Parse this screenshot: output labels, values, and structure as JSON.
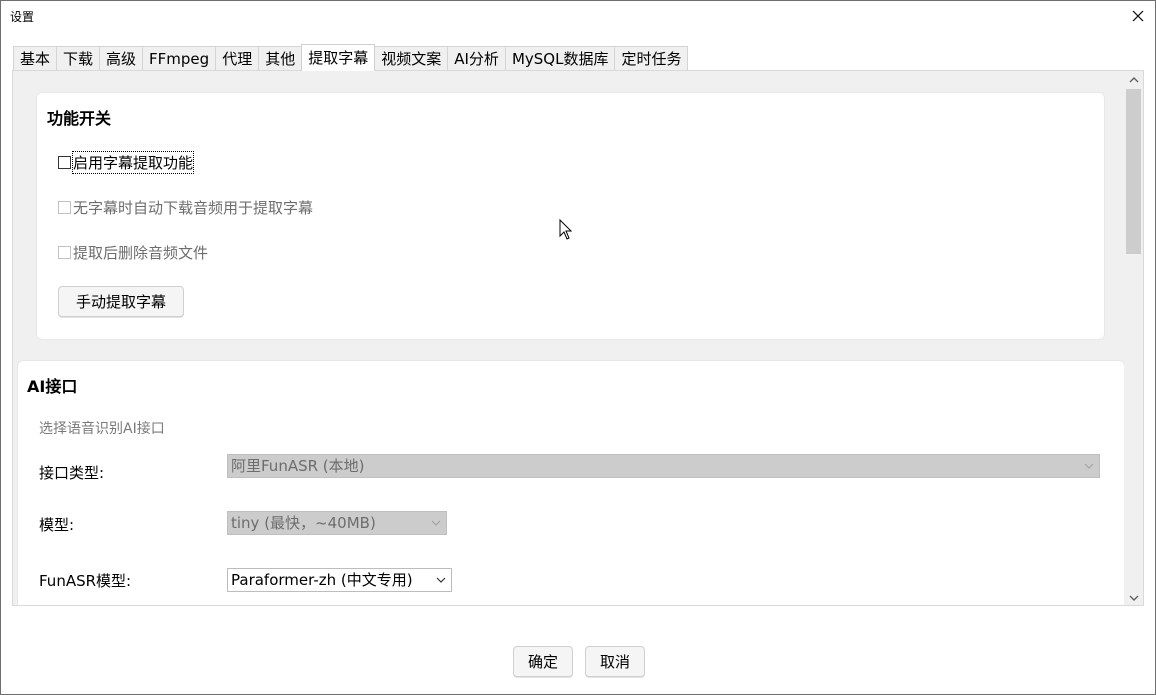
{
  "window": {
    "title": "设置"
  },
  "tabs": [
    {
      "label": "基本"
    },
    {
      "label": "下载"
    },
    {
      "label": "高级"
    },
    {
      "label": "FFmpeg"
    },
    {
      "label": "代理"
    },
    {
      "label": "其他"
    },
    {
      "label": "提取字幕",
      "active": true
    },
    {
      "label": "视频文案"
    },
    {
      "label": "AI分析"
    },
    {
      "label": "MySQL数据库"
    },
    {
      "label": "定时任务"
    }
  ],
  "feature_group": {
    "title": "功能开关",
    "enable_extract": {
      "label": "启用字幕提取功能",
      "checked": false,
      "enabled": true
    },
    "auto_download_audio": {
      "label": "无字幕时自动下载音频用于提取字幕",
      "checked": false,
      "enabled": false
    },
    "delete_audio": {
      "label": "提取后删除音频文件",
      "checked": false,
      "enabled": false
    },
    "manual_button": "手动提取字幕"
  },
  "ai_group": {
    "title": "AI接口",
    "hint": "选择语音识别AI接口",
    "interface_label": "接口类型:",
    "interface_value": "阿里FunASR (本地)",
    "model_label": "模型:",
    "model_value": "tiny (最快，~40MB)",
    "funasr_label": "FunASR模型:",
    "funasr_value": "Paraformer-zh (中文专用)"
  },
  "footer": {
    "ok": "确定",
    "cancel": "取消"
  },
  "colors": {
    "disabled_select_bg": "#cccccc",
    "pane_bg": "#f0f0f0"
  }
}
